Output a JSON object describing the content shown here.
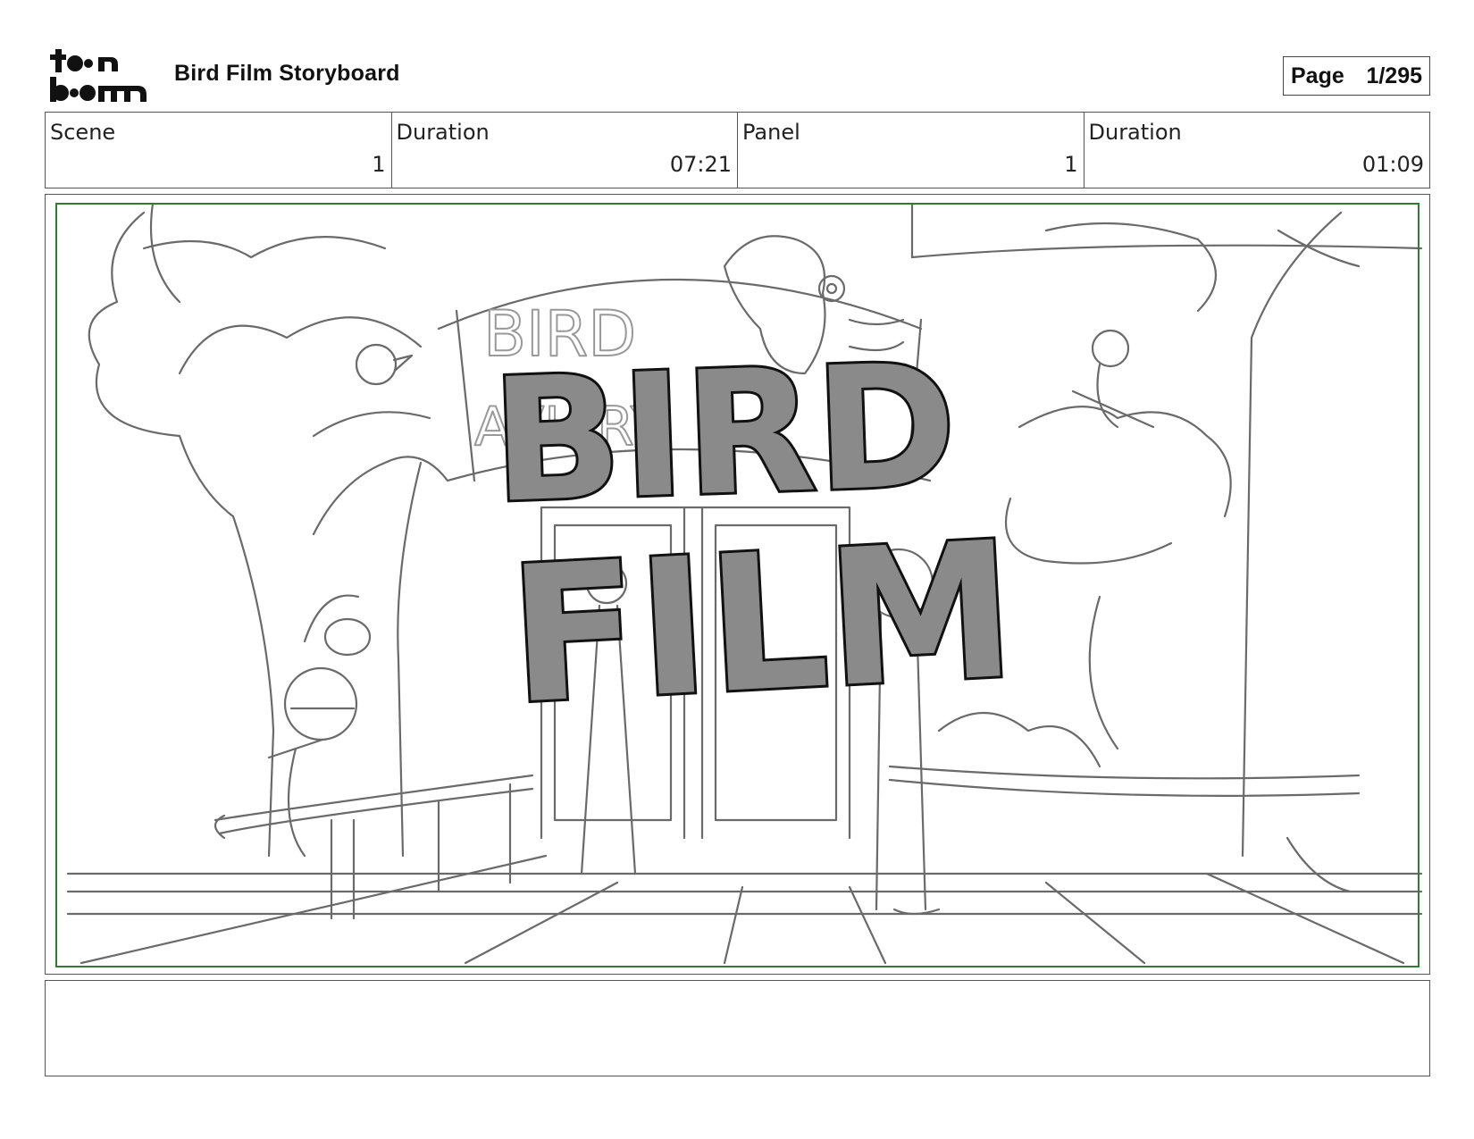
{
  "header": {
    "logo_text": "toon boom",
    "title": "Bird Film Storyboard",
    "page_label": "Page",
    "page_number": "1/295"
  },
  "info": {
    "scene_label": "Scene",
    "scene_value": "1",
    "scene_duration_label": "Duration",
    "scene_duration_value": "07:21",
    "panel_label": "Panel",
    "panel_value": "1",
    "panel_duration_label": "Duration",
    "panel_duration_value": "01:09"
  },
  "panel": {
    "title_line1": "BIRD",
    "title_line2": "FILM",
    "sign_text": "BIRD AVIARY",
    "safe_frame_color": "#2e7d32",
    "title_fill": "#8a8a8a"
  },
  "notes": {
    "text": ""
  }
}
